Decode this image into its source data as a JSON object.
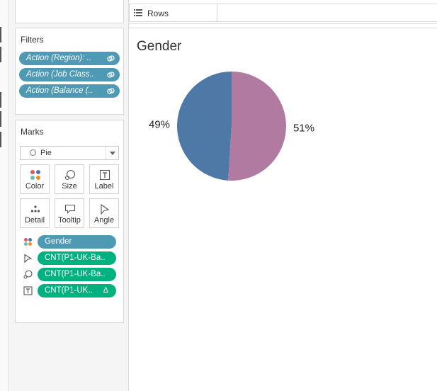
{
  "filters": {
    "title": "Filters",
    "items": [
      {
        "label": "Action (Region): .."
      },
      {
        "label": "Action (Job Class.."
      },
      {
        "label": "Action (Balance (.."
      }
    ]
  },
  "marks": {
    "title": "Marks",
    "mark_type": "Pie",
    "buttons": [
      {
        "label": "Color",
        "icon": "color-dots-icon"
      },
      {
        "label": "Size",
        "icon": "size-icon"
      },
      {
        "label": "Label",
        "icon": "label-icon"
      },
      {
        "label": "Detail",
        "icon": "detail-icon"
      },
      {
        "label": "Tooltip",
        "icon": "tooltip-icon"
      },
      {
        "label": "Angle",
        "icon": "angle-icon"
      }
    ],
    "shelf": [
      {
        "label": "Gender",
        "kind": "dimension",
        "icon": "color-dots-icon"
      },
      {
        "label": "CNT(P1-UK-Ba..",
        "kind": "measure",
        "icon": "angle-icon"
      },
      {
        "label": "CNT(P1-UK-Ba..",
        "kind": "measure",
        "icon": "size-icon"
      },
      {
        "label": "CNT(P1-UK..",
        "kind": "measure",
        "icon": "label-icon",
        "delta": "Δ"
      }
    ]
  },
  "rows": {
    "label": "Rows"
  },
  "colors": {
    "dimension_pill": "#4e99b4",
    "measure_pill": "#00b180",
    "slice_blue": "#4e79a7",
    "slice_pink": "#b07aa1"
  },
  "chart_data": {
    "type": "pie",
    "title": "Gender",
    "slices": [
      {
        "label": "49%",
        "value": 49,
        "color": "#4e79a7"
      },
      {
        "label": "51%",
        "value": 51,
        "color": "#b07aa1"
      }
    ]
  }
}
